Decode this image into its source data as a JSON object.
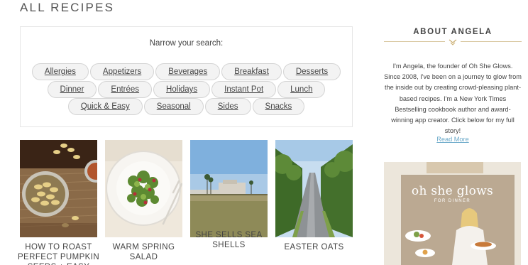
{
  "page": {
    "title": "ALL RECIPES"
  },
  "filter": {
    "heading": "Narrow your search:",
    "row1": [
      "Allergies",
      "Appetizers",
      "Beverages",
      "Breakfast",
      "Desserts"
    ],
    "row2": [
      "Dinner",
      "Entrées",
      "Holidays",
      "Instant Pot",
      "Lunch"
    ],
    "row3": [
      "Quick & Easy",
      "Seasonal",
      "Sides",
      "Snacks"
    ]
  },
  "recipes": [
    {
      "title": "HOW TO ROAST PERFECT PUMPKIN SEEDS + EASY",
      "image": "roasted-pumpkin-seeds-photo"
    },
    {
      "title": "WARM SPRING SALAD",
      "image": "spring-salad-plate-photo"
    },
    {
      "title": "SHE SELLS SEA SHELLS",
      "image": "beach-hotel-photo"
    },
    {
      "title": "EASTER OATS",
      "image": "tree-lined-road-photo"
    }
  ],
  "about": {
    "heading": "ABOUT ANGELA",
    "text": "I'm Angela, the founder of Oh She Glows. Since 2008, I've been on a journey to glow from the inside out by creating crowd-pleasing plant-based recipes. I'm a New York Times Bestselling cookbook author and award-winning app creator. Click below for my full story!",
    "read_more": "Read More"
  },
  "book": {
    "title": "oh she glows",
    "subtitle": "FOR DINNER",
    "image": "cookbook-cover"
  },
  "colors": {
    "accent": "#d9c7a0",
    "link": "#6aa9c9",
    "chip_bg": "#f3f3f3"
  }
}
